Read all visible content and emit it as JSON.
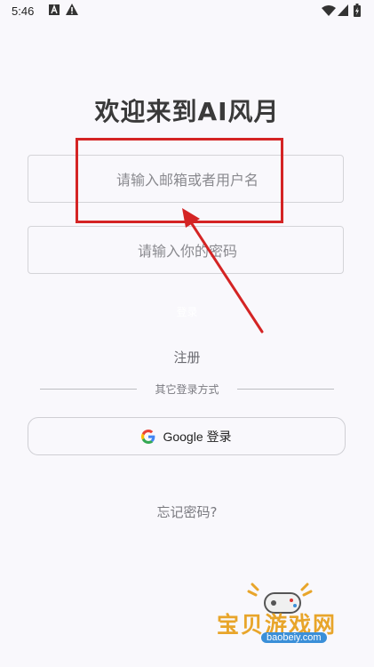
{
  "status_bar": {
    "time": "5:46"
  },
  "page": {
    "title": "欢迎来到AI风月",
    "username_placeholder": "请输入邮箱或者用户名",
    "password_placeholder": "请输入你的密码",
    "login_label": "登录",
    "register_label": "注册",
    "other_login_label": "其它登录方式",
    "google_login_label": "Google 登录",
    "forgot_password_label": "忘记密码?"
  },
  "watermark": {
    "text": "宝贝游戏网",
    "url": "baobeiy.com"
  },
  "colors": {
    "annotation": "#d42424",
    "watermark": "#e8a52a"
  }
}
